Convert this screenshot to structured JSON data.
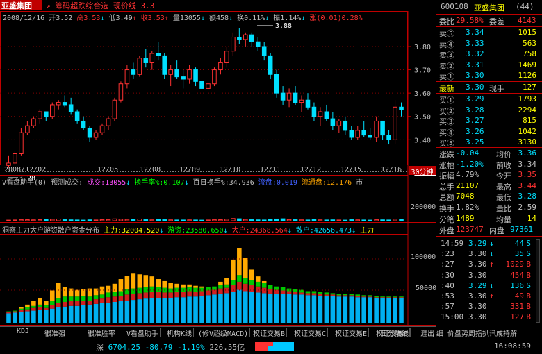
{
  "colors": {
    "up": "#ff3232",
    "down": "#00e0ff",
    "yellow": "#ffff00",
    "frame": "#c00000",
    "text": "#c0c0c0",
    "magenta": "#ff50ff",
    "green": "#00ff00",
    "orange": "#ffa500"
  },
  "header": {
    "stock_name": "亚盛集团",
    "subtitle": "筹码超跌综合选 现价线 3.3",
    "date": "2008/12/16",
    "open": "开3.52",
    "high": "高3.53",
    "low": "低3.49",
    "close": "收3.53",
    "volume": "量13055",
    "amount": "额458",
    "turnover": "换0.11%",
    "amplitude": "振1.14%",
    "change": "涨(0.01)0.28%",
    "hi_mark": "3.88",
    "lo_mark": "3.28",
    "current_price_tag": "3.30",
    "price_ticks": [
      "3.80",
      "3.70",
      "3.60",
      "3.50",
      "3.40"
    ]
  },
  "xaxis": {
    "dates": [
      "2008/12/02",
      "12/05",
      "12/08",
      "12/09",
      "12/10",
      "12/11",
      "12/12",
      "12/15",
      "12/16"
    ],
    "period": "30分钟"
  },
  "indicator1": {
    "name": "V看盘助手(0)",
    "pred_label": "预测成交:",
    "cj": "成交:13055",
    "hs": "换手率%:0.107",
    "bb": "百日换手%:34.936",
    "ld": "流盘:0.019",
    "lt": "流通盘:12.176",
    "tail": "市",
    "tick": "200000"
  },
  "indicator2": {
    "title": "洞察主力大户游资散户资金分布",
    "zl": "主力:32004.520",
    "yz": "游资:23580.650",
    "dh": "大户:24368.564",
    "sh": "散户:42656.473",
    "tail": "主力",
    "ticks": [
      "100000",
      "50000"
    ]
  },
  "tabs": [
    "KDJ",
    "很准强",
    "很准胜率",
    "V看盘助手",
    "机构K线",
    "(修V超级MACD)",
    "权证交易B",
    "权证交易C",
    "权证交易E",
    "权证交易F",
    "日分隔线",
    "涯出"
  ],
  "tabs_right": "细 价盘势周指扒讯成持解",
  "statusbar": {
    "index_name": "深",
    "index_value": "6704.25",
    "index_change": "-80.79",
    "index_pct": "-1.19%",
    "index_amount": "226.55亿",
    "time": "16:08:59"
  },
  "quote": {
    "code": "600108",
    "name": "亚盛集团",
    "days": "(44)",
    "wb_label": "委比",
    "wb_value": "29.58%",
    "wc_label": "委差",
    "wc_value": "4143",
    "asks": [
      {
        "label": "卖⑤",
        "price": "3.34",
        "vol": "1015"
      },
      {
        "label": "卖④",
        "price": "3.33",
        "vol": "563"
      },
      {
        "label": "卖③",
        "price": "3.32",
        "vol": "758"
      },
      {
        "label": "卖②",
        "price": "3.31",
        "vol": "1469"
      },
      {
        "label": "卖①",
        "price": "3.30",
        "vol": "1126"
      }
    ],
    "last_label": "最新",
    "last_price": "3.30",
    "last_hand_label": "现手",
    "last_hand": "127",
    "bids": [
      {
        "label": "买①",
        "price": "3.29",
        "vol": "1793"
      },
      {
        "label": "买②",
        "price": "3.28",
        "vol": "2294"
      },
      {
        "label": "买③",
        "price": "3.27",
        "vol": "815"
      },
      {
        "label": "买④",
        "price": "3.26",
        "vol": "1042"
      },
      {
        "label": "买⑤",
        "price": "3.25",
        "vol": "3130"
      }
    ],
    "stats": [
      {
        "l1": "涨跌",
        "v1": "-0.04",
        "l2": "均价",
        "v2": "3.36"
      },
      {
        "l1": "涨幅",
        "v1": "-1.20%",
        "l2": "前收",
        "v2": "3.34"
      },
      {
        "l1": "振幅",
        "v1": "4.79%",
        "l2": "今开",
        "v2": "3.35"
      },
      {
        "l1": "总手",
        "v1": "21107",
        "l2": "最高",
        "v2": "3.44"
      },
      {
        "l1": "总额",
        "v1": "7048",
        "l2": "最低",
        "v2": "3.28"
      },
      {
        "l1": "换手",
        "v1": "1.82%",
        "l2": "量比",
        "v2": "2.59"
      },
      {
        "l1": "分笔",
        "v1": "1489",
        "l2": "均量",
        "v2": "14"
      }
    ],
    "outer_label": "外盘",
    "outer": "123747",
    "inner_label": "内盘",
    "inner": "97361",
    "ticks": [
      {
        "t": "14:59",
        "p": "3.29",
        "d": "↓",
        "v": "44",
        "s": "S"
      },
      {
        "t": ":23",
        "p": "3.30",
        "d": "↓",
        "v": "35",
        "s": "S"
      },
      {
        "t": ":27",
        "p": "3.30",
        "d": "↑",
        "v": "1029",
        "s": "B"
      },
      {
        "t": ":30",
        "p": "3.30",
        "d": "",
        "v": "454",
        "s": "B"
      },
      {
        "t": ":40",
        "p": "3.29",
        "d": "↓",
        "v": "136",
        "s": "S"
      },
      {
        "t": ":53",
        "p": "3.30",
        "d": "↑",
        "v": "49",
        "s": "B"
      },
      {
        "t": ":57",
        "p": "3.30",
        "d": "",
        "v": "331",
        "s": "B"
      },
      {
        "t": "15:00",
        "p": "3.30",
        "d": "",
        "v": "127",
        "s": "B"
      }
    ]
  },
  "chart_data": {
    "type": "candlestick",
    "candles": [
      [
        3.29,
        3.33,
        3.28,
        3.3
      ],
      [
        3.3,
        3.35,
        3.29,
        3.34
      ],
      [
        3.34,
        3.45,
        3.33,
        3.43
      ],
      [
        3.43,
        3.48,
        3.42,
        3.46
      ],
      [
        3.46,
        3.5,
        3.45,
        3.49
      ],
      [
        3.49,
        3.53,
        3.47,
        3.52
      ],
      [
        3.52,
        3.51,
        3.48,
        3.5
      ],
      [
        3.5,
        3.56,
        3.49,
        3.55
      ],
      [
        3.55,
        3.57,
        3.53,
        3.56
      ],
      [
        3.56,
        3.59,
        3.54,
        3.55
      ],
      [
        3.55,
        3.58,
        3.51,
        3.52
      ],
      [
        3.52,
        3.53,
        3.47,
        3.48
      ],
      [
        3.48,
        3.5,
        3.44,
        3.45
      ],
      [
        3.45,
        3.46,
        3.39,
        3.41
      ],
      [
        3.41,
        3.44,
        3.4,
        3.43
      ],
      [
        3.43,
        3.47,
        3.42,
        3.46
      ],
      [
        3.46,
        3.5,
        3.44,
        3.49
      ],
      [
        3.49,
        3.58,
        3.48,
        3.57
      ],
      [
        3.57,
        3.65,
        3.56,
        3.64
      ],
      [
        3.64,
        3.72,
        3.62,
        3.7
      ],
      [
        3.7,
        3.73,
        3.66,
        3.68
      ],
      [
        3.68,
        3.76,
        3.67,
        3.75
      ],
      [
        3.75,
        3.79,
        3.71,
        3.73
      ],
      [
        3.73,
        3.78,
        3.7,
        3.77
      ],
      [
        3.77,
        3.82,
        3.74,
        3.76
      ],
      [
        3.76,
        3.77,
        3.66,
        3.68
      ],
      [
        3.68,
        3.72,
        3.63,
        3.7
      ],
      [
        3.7,
        3.74,
        3.66,
        3.67
      ],
      [
        3.67,
        3.7,
        3.62,
        3.66
      ],
      [
        3.66,
        3.72,
        3.64,
        3.7
      ],
      [
        3.7,
        3.71,
        3.63,
        3.65
      ],
      [
        3.65,
        3.68,
        3.6,
        3.62
      ],
      [
        3.62,
        3.66,
        3.58,
        3.64
      ],
      [
        3.64,
        3.71,
        3.63,
        3.7
      ],
      [
        3.7,
        3.75,
        3.68,
        3.73
      ],
      [
        3.73,
        3.8,
        3.71,
        3.78
      ],
      [
        3.78,
        3.86,
        3.76,
        3.84
      ],
      [
        3.84,
        3.88,
        3.81,
        3.83
      ],
      [
        3.83,
        3.86,
        3.8,
        3.85
      ],
      [
        3.85,
        3.86,
        3.8,
        3.82
      ],
      [
        3.82,
        3.84,
        3.78,
        3.8
      ],
      [
        3.8,
        3.82,
        3.74,
        3.76
      ],
      [
        3.76,
        3.77,
        3.66,
        3.68
      ],
      [
        3.68,
        3.7,
        3.58,
        3.6
      ],
      [
        3.6,
        3.63,
        3.55,
        3.57
      ],
      [
        3.57,
        3.62,
        3.54,
        3.6
      ],
      [
        3.6,
        3.63,
        3.55,
        3.56
      ],
      [
        3.56,
        3.59,
        3.52,
        3.57
      ],
      [
        3.57,
        3.6,
        3.53,
        3.54
      ],
      [
        3.54,
        3.56,
        3.48,
        3.5
      ],
      [
        3.5,
        3.54,
        3.46,
        3.52
      ],
      [
        3.52,
        3.55,
        3.48,
        3.49
      ],
      [
        3.49,
        3.52,
        3.44,
        3.46
      ],
      [
        3.46,
        3.49,
        3.43,
        3.48
      ],
      [
        3.48,
        3.5,
        3.42,
        3.44
      ],
      [
        3.44,
        3.46,
        3.4,
        3.41
      ],
      [
        3.41,
        3.46,
        3.4,
        3.44
      ],
      [
        3.44,
        3.48,
        3.41,
        3.42
      ],
      [
        3.42,
        3.45,
        3.4,
        3.41
      ],
      [
        3.41,
        3.5,
        3.39,
        3.48
      ],
      [
        3.48,
        3.46,
        3.4,
        3.42
      ],
      [
        3.42,
        3.44,
        3.38,
        3.4
      ],
      [
        3.4,
        3.57,
        3.38,
        3.54
      ],
      [
        3.54,
        3.56,
        3.5,
        3.53
      ]
    ],
    "ylim": [
      3.27,
      3.91
    ],
    "volume": [
      5000,
      6000,
      9000,
      8000,
      7000,
      8000,
      9000,
      11000,
      14000,
      8000,
      7000,
      6000,
      5000,
      7000,
      6000,
      8000,
      9000,
      15000,
      12000,
      10000,
      9000,
      14000,
      8000,
      7000,
      9000,
      8000,
      7000,
      6000,
      6000,
      7000,
      6000,
      5000,
      6000,
      9000,
      8000,
      12000,
      18000,
      16000,
      10000,
      8000,
      7000,
      6000,
      9000,
      14000,
      16000,
      9000,
      8000,
      7000,
      6000,
      9000,
      7000,
      6000,
      7000,
      6000,
      5000,
      8000,
      7000,
      6000,
      5000,
      9000,
      7000,
      6000,
      12000,
      13055
    ],
    "vol_ylim": [
      0,
      300000
    ],
    "fund": [
      [
        15,
        2,
        1,
        0
      ],
      [
        16,
        2,
        1,
        0
      ],
      [
        17,
        3,
        2,
        2
      ],
      [
        18,
        3,
        3,
        4
      ],
      [
        19,
        4,
        3,
        8
      ],
      [
        20,
        4,
        4,
        10
      ],
      [
        20,
        3,
        4,
        6
      ],
      [
        22,
        5,
        6,
        16
      ],
      [
        24,
        6,
        8,
        22
      ],
      [
        25,
        7,
        8,
        14
      ],
      [
        26,
        7,
        7,
        12
      ],
      [
        26,
        7,
        7,
        10
      ],
      [
        27,
        7,
        7,
        10
      ],
      [
        28,
        6,
        6,
        12
      ],
      [
        29,
        7,
        6,
        10
      ],
      [
        30,
        7,
        6,
        12
      ],
      [
        31,
        8,
        7,
        10
      ],
      [
        32,
        8,
        7,
        12
      ],
      [
        33,
        8,
        7,
        18
      ],
      [
        34,
        9,
        8,
        20
      ],
      [
        35,
        9,
        8,
        22
      ],
      [
        36,
        9,
        8,
        20
      ],
      [
        37,
        9,
        8,
        18
      ],
      [
        38,
        9,
        8,
        15
      ],
      [
        38,
        9,
        7,
        12
      ],
      [
        38,
        8,
        7,
        10
      ],
      [
        38,
        8,
        6,
        8
      ],
      [
        39,
        8,
        6,
        6
      ],
      [
        39,
        8,
        6,
        5
      ],
      [
        40,
        8,
        6,
        4
      ],
      [
        40,
        7,
        6,
        3
      ],
      [
        41,
        7,
        5,
        2
      ],
      [
        42,
        7,
        5,
        0
      ],
      [
        43,
        7,
        5,
        0
      ],
      [
        44,
        8,
        5,
        5
      ],
      [
        45,
        8,
        5,
        10
      ],
      [
        47,
        10,
        8,
        30
      ],
      [
        50,
        12,
        10,
        40
      ],
      [
        48,
        11,
        9,
        30
      ],
      [
        47,
        10,
        8,
        15
      ],
      [
        46,
        9,
        7,
        8
      ],
      [
        45,
        8,
        7,
        3
      ],
      [
        44,
        7,
        6,
        0
      ],
      [
        44,
        6,
        5,
        0
      ],
      [
        44,
        5,
        5,
        0
      ],
      [
        44,
        4,
        4,
        0
      ],
      [
        43,
        4,
        4,
        0
      ],
      [
        43,
        3,
        4,
        0
      ],
      [
        42,
        3,
        3,
        0
      ],
      [
        42,
        3,
        3,
        0
      ],
      [
        41,
        3,
        3,
        0
      ],
      [
        41,
        2,
        3,
        0
      ],
      [
        41,
        2,
        2,
        0
      ],
      [
        40,
        2,
        2,
        0
      ],
      [
        40,
        2,
        2,
        0
      ],
      [
        40,
        2,
        2,
        0
      ],
      [
        39,
        2,
        2,
        0
      ],
      [
        39,
        1,
        2,
        0
      ],
      [
        39,
        1,
        2,
        0
      ],
      [
        38,
        1,
        2,
        0
      ],
      [
        38,
        1,
        1,
        0
      ],
      [
        38,
        1,
        1,
        0
      ],
      [
        38,
        1,
        1,
        0
      ],
      [
        38,
        1,
        1,
        0
      ]
    ],
    "fund_ylim": [
      0,
      130000
    ]
  }
}
